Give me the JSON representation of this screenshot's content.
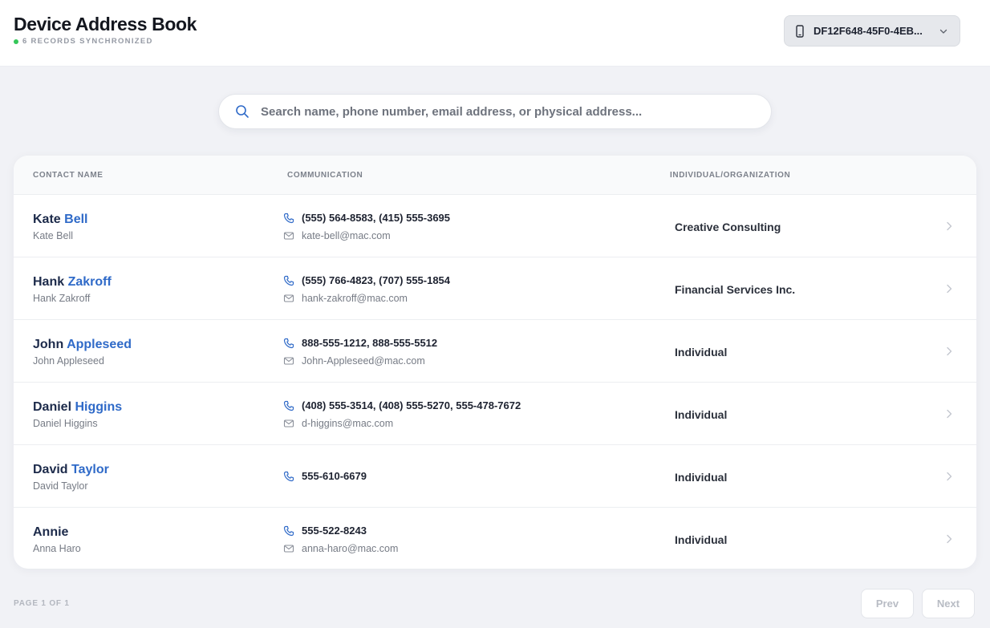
{
  "header": {
    "title": "Device Address Book",
    "sync_status": "6 RECORDS SYNCHRONIZED",
    "device_id": "DF12F648-45F0-4EB..."
  },
  "search": {
    "placeholder": "Search name, phone number, email address, or physical address..."
  },
  "table": {
    "columns": {
      "name": "CONTACT NAME",
      "communication": "COMMUNICATION",
      "org": "INDIVIDUAL/ORGANIZATION"
    },
    "rows": [
      {
        "first": "Kate",
        "last": "Bell",
        "sub": "Kate Bell",
        "phones": "(555) 564-8583, (415) 555-3695",
        "email": "kate-bell@mac.com",
        "org": "Creative Consulting"
      },
      {
        "first": "Hank",
        "last": "Zakroff",
        "sub": "Hank Zakroff",
        "phones": "(555) 766-4823, (707) 555-1854",
        "email": "hank-zakroff@mac.com",
        "org": "Financial Services Inc."
      },
      {
        "first": "John",
        "last": "Appleseed",
        "sub": "John Appleseed",
        "phones": "888-555-1212, 888-555-5512",
        "email": "John-Appleseed@mac.com",
        "org": "Individual"
      },
      {
        "first": "Daniel",
        "last": "Higgins",
        "sub": "Daniel Higgins",
        "phones": "(408) 555-3514, (408) 555-5270, 555-478-7672",
        "email": "d-higgins@mac.com",
        "org": "Individual"
      },
      {
        "first": "David",
        "last": "Taylor",
        "sub": "David Taylor",
        "phones": "555-610-6679",
        "email": "",
        "org": "Individual"
      },
      {
        "first": "Annie",
        "last": "",
        "sub": "Anna Haro",
        "phones": "555-522-8243",
        "email": "anna-haro@mac.com",
        "org": "Individual"
      }
    ]
  },
  "pagination": {
    "label": "PAGE 1 OF 1",
    "prev": "Prev",
    "next": "Next"
  },
  "colors": {
    "accent": "#2f6ac8",
    "sync_dot": "#34c759",
    "name_dark": "#1c2a4a"
  },
  "icons": {
    "device": "phone-icon",
    "dropdown": "chevron-down-icon",
    "search": "search-icon",
    "phone": "phone-icon",
    "email": "mail-icon",
    "row": "chevron-right-icon"
  }
}
